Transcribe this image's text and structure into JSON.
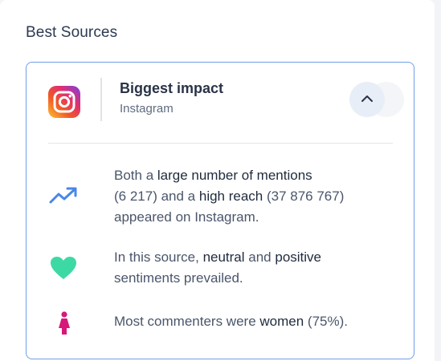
{
  "panel": {
    "title": "Best Sources"
  },
  "card": {
    "title": "Biggest impact",
    "subtitle": "Instagram",
    "source_icon": "instagram-logo",
    "toggle_icon": "chevron-up-icon"
  },
  "insights": [
    {
      "icon": "trend-up-icon",
      "icon_color": "#4a86e8",
      "parts": [
        "Both a ",
        "large number of mentions",
        " (6 217) and a ",
        "high reach",
        " (37 876 767) appeared on Instagram."
      ]
    },
    {
      "icon": "heart-icon",
      "icon_color": "#3dd9a4",
      "parts": [
        "In this source, ",
        "neutral",
        " and ",
        "positive",
        " sentiments prevailed."
      ]
    },
    {
      "icon": "woman-icon",
      "icon_color": "#d6197a",
      "parts": [
        "Most commenters were ",
        "women",
        " (75%)."
      ]
    }
  ]
}
